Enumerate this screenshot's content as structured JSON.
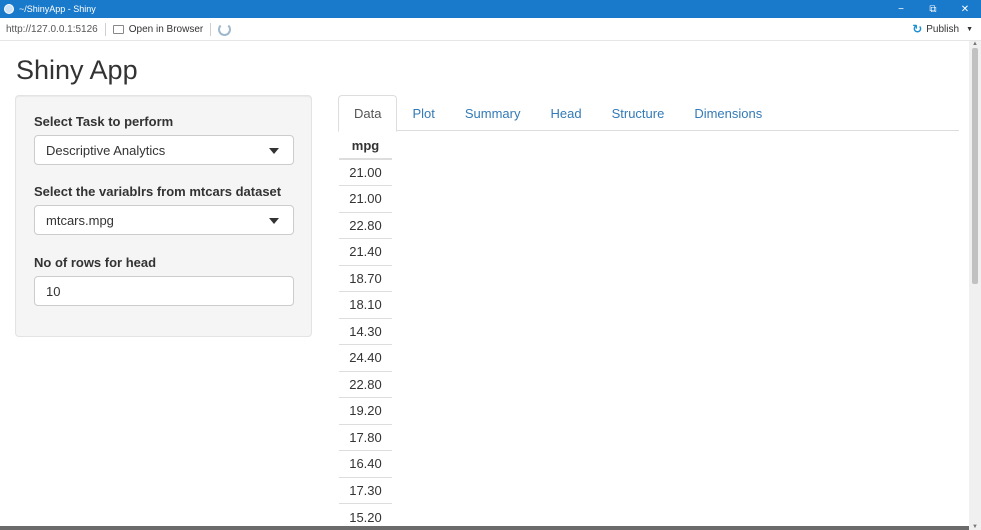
{
  "window": {
    "title": "~/ShinyApp - Shiny",
    "minimize": "−",
    "restore": "⧉",
    "close": "✕"
  },
  "toolbar": {
    "url": "http://127.0.0.1:5126",
    "open_in_browser": "Open in Browser",
    "publish": "Publish"
  },
  "app": {
    "title": "Shiny App"
  },
  "sidebar": {
    "task_label": "Select Task to perform",
    "task_value": "Descriptive Analytics",
    "variable_label": "Select the variablrs from mtcars dataset",
    "variable_value": "mtcars.mpg",
    "rows_label": "No of rows for head",
    "rows_value": "10"
  },
  "tabs": [
    {
      "label": "Data",
      "active": true
    },
    {
      "label": "Plot",
      "active": false
    },
    {
      "label": "Summary",
      "active": false
    },
    {
      "label": "Head",
      "active": false
    },
    {
      "label": "Structure",
      "active": false
    },
    {
      "label": "Dimensions",
      "active": false
    }
  ],
  "table": {
    "header": "mpg",
    "rows": [
      "21.00",
      "21.00",
      "22.80",
      "21.40",
      "18.70",
      "18.10",
      "14.30",
      "24.40",
      "22.80",
      "19.20",
      "17.80",
      "16.40",
      "17.30",
      "15.20"
    ]
  },
  "colors": {
    "titlebar": "#1979ca",
    "link": "#337ab7",
    "publish_icon": "#1a8fd4"
  }
}
